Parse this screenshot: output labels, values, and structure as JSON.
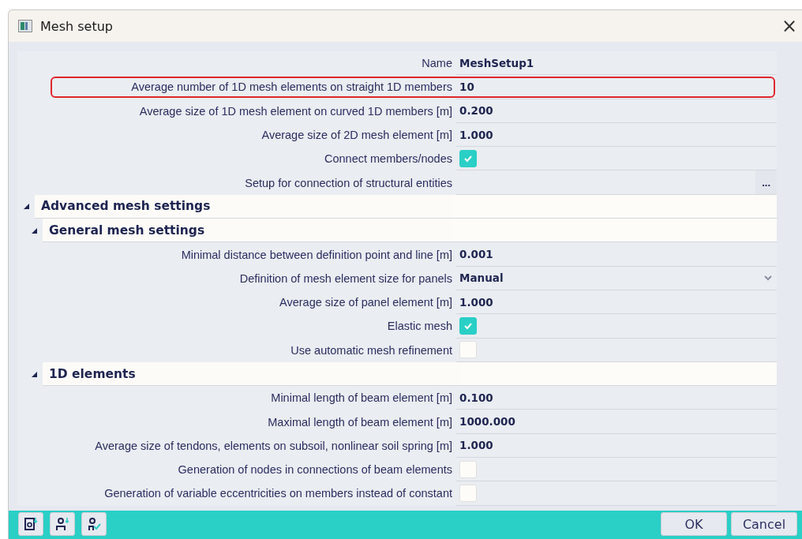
{
  "window": {
    "title": "Mesh setup",
    "close": "×"
  },
  "rows": [
    {
      "kind": "text",
      "label": "Name",
      "value": "MeshSetup1",
      "highlighted": false
    },
    {
      "kind": "text",
      "label": "Average number of 1D mesh elements on straight 1D members",
      "value": "10",
      "highlighted": true
    },
    {
      "kind": "text",
      "label": "Average size of 1D mesh element on curved 1D members [m]",
      "value": "0.200",
      "highlighted": false
    },
    {
      "kind": "text",
      "label": "Average size of 2D mesh element [m]",
      "value": "1.000",
      "highlighted": false
    },
    {
      "kind": "check",
      "label": "Connect members/nodes",
      "checked": true,
      "highlighted": false
    },
    {
      "kind": "ellipsis",
      "label": "Setup for connection of structural entities",
      "button": "...",
      "highlighted": false
    }
  ],
  "sections": [
    {
      "title": "Advanced mesh settings",
      "expanded": true,
      "children": [
        {
          "title": "General mesh settings",
          "expanded": true,
          "rows": [
            {
              "kind": "text",
              "label": "Minimal distance between definition point and line [m]",
              "value": "0.001",
              "highlighted": false
            },
            {
              "kind": "dropdown",
              "label": "Definition of mesh element size for panels",
              "value": "Manual",
              "highlighted": false
            },
            {
              "kind": "text",
              "label": "Average size of panel element [m]",
              "value": "1.000",
              "highlighted": false
            },
            {
              "kind": "check",
              "label": "Elastic mesh",
              "checked": true,
              "highlighted": false
            },
            {
              "kind": "check",
              "label": "Use automatic mesh refinement",
              "checked": false,
              "highlighted": false
            }
          ]
        },
        {
          "title": "1D elements",
          "expanded": true,
          "rows": [
            {
              "kind": "text",
              "label": "Minimal length of beam element [m]",
              "value": "0.100",
              "highlighted": false
            },
            {
              "kind": "text",
              "label": "Maximal length of beam element [m]",
              "value": "1000.000",
              "highlighted": false
            },
            {
              "kind": "text",
              "label": "Average size of tendons, elements on subsoil, nonlinear soil spring [m]",
              "value": "1.000",
              "highlighted": false
            },
            {
              "kind": "check",
              "label": "Generation of nodes in connections of beam elements",
              "checked": false,
              "highlighted": false
            },
            {
              "kind": "check",
              "label": "Generation of variable eccentricities on members instead of constant",
              "checked": false,
              "highlighted": false
            }
          ]
        }
      ]
    }
  ],
  "buttons": [
    {
      "label": "OK"
    },
    {
      "label": "Cancel"
    }
  ]
}
